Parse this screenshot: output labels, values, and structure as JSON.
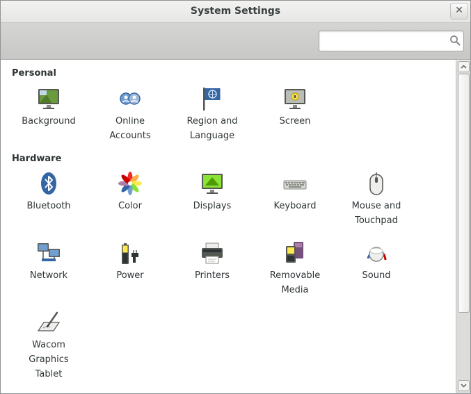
{
  "window": {
    "title": "System Settings",
    "close_label": "✕"
  },
  "search": {
    "value": "",
    "placeholder": ""
  },
  "sections": {
    "personal": {
      "title": "Personal",
      "items": [
        {
          "lines": [
            "Background"
          ],
          "icon": "background-icon"
        },
        {
          "lines": [
            "Online",
            "Accounts"
          ],
          "icon": "online-accounts-icon"
        },
        {
          "lines": [
            "Region and",
            "Language"
          ],
          "icon": "region-flag-icon"
        },
        {
          "lines": [
            "Screen"
          ],
          "icon": "screen-icon"
        }
      ]
    },
    "hardware": {
      "title": "Hardware",
      "items": [
        {
          "lines": [
            "Bluetooth"
          ],
          "icon": "bluetooth-icon"
        },
        {
          "lines": [
            "Color"
          ],
          "icon": "color-icon"
        },
        {
          "lines": [
            "Displays"
          ],
          "icon": "displays-icon"
        },
        {
          "lines": [
            "Keyboard"
          ],
          "icon": "keyboard-icon"
        },
        {
          "lines": [
            "Mouse and",
            "Touchpad"
          ],
          "icon": "mouse-icon"
        },
        {
          "lines": [
            "Network"
          ],
          "icon": "network-icon"
        },
        {
          "lines": [
            "Power"
          ],
          "icon": "power-icon"
        },
        {
          "lines": [
            "Printers"
          ],
          "icon": "printer-icon"
        },
        {
          "lines": [
            "Removable",
            "Media"
          ],
          "icon": "removable-media-icon"
        },
        {
          "lines": [
            "Sound"
          ],
          "icon": "sound-icon"
        },
        {
          "lines": [
            "Wacom",
            "Graphics",
            "Tablet"
          ],
          "icon": "wacom-tablet-icon"
        }
      ]
    }
  },
  "colors": {
    "accent": "#3465a4",
    "toolbar": "#cfcfcd",
    "text": "#2e3436"
  }
}
